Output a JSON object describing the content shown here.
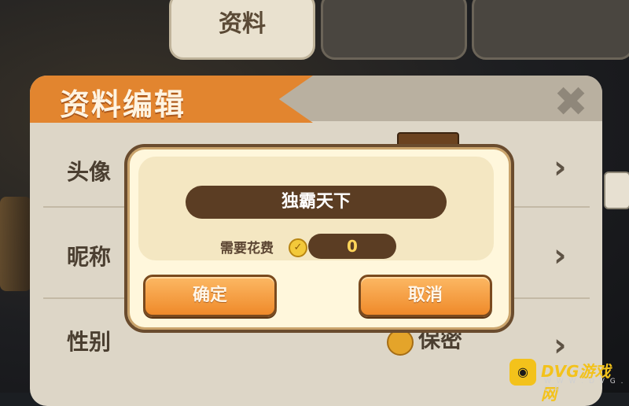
{
  "tabs": [
    {
      "label": "资料",
      "active": true
    },
    {
      "label": "",
      "active": false
    },
    {
      "label": "",
      "active": false
    }
  ],
  "panel": {
    "title": "资料编辑",
    "close_icon": "close-x-icon",
    "rows": [
      {
        "label": "头像"
      },
      {
        "label": "昵称"
      },
      {
        "label": "性别",
        "value": "保密"
      }
    ]
  },
  "dialog": {
    "name_value": "独霸天下",
    "cost_label": "需要花费",
    "cost_value": "0",
    "confirm_label": "确定",
    "cancel_label": "取消"
  },
  "watermark": {
    "text": "DVG游戏网",
    "sub": "W W W . D V G . C N"
  },
  "colors": {
    "accent_orange": "#ef8a2a",
    "dialog_bg": "#fff7dc",
    "dark_brown": "#5b3d23"
  }
}
